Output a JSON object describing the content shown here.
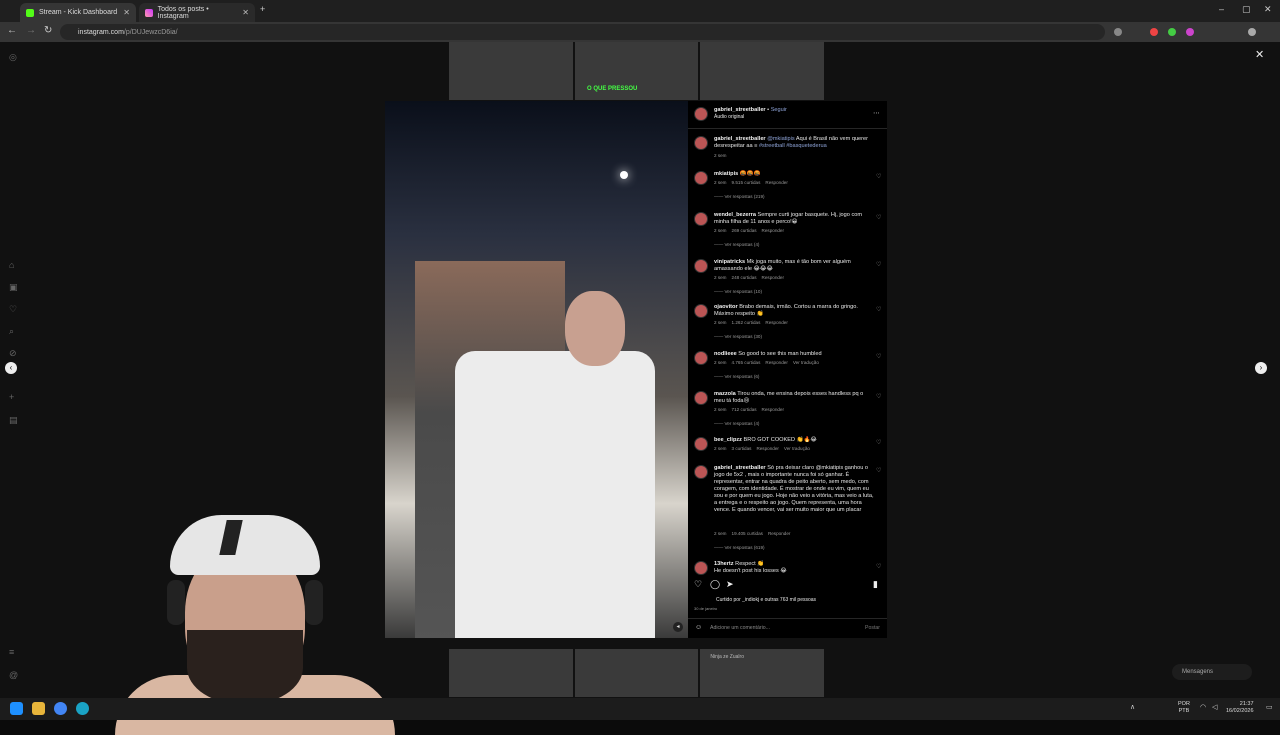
{
  "browser": {
    "tabs": [
      {
        "title": "Stream - Kick Dashboard"
      },
      {
        "title": "Todos os posts • Instagram"
      }
    ],
    "url_host": "instagram.com",
    "url_path": "/p/DUJewzcD6ia/"
  },
  "post": {
    "author": "gabriel_streetballer",
    "follow_label": "Seguir",
    "audio": "Áudio original",
    "caption_user": "gabriel_streetballer",
    "caption_mention": "@mkiatipis",
    "caption_text": "Aqui é Brasil não vem querer desrespeitar aa",
    "caption_tags": "#streetball #basquetederua",
    "caption_time": "2 sem",
    "comments": [
      {
        "user": "mkiatipis",
        "text": "🤬🤬🤬",
        "time": "2 sem",
        "likes": "9.515 curtidas",
        "reply": "Responder",
        "replies": "Ver respostas (219)"
      },
      {
        "user": "wendel_bezerra",
        "text": "Sempre curti jogar basquete. Hj, jogo com minha filha de 11 anos e perco!😁",
        "time": "2 sem",
        "likes": "269 curtidas",
        "reply": "Responder",
        "replies": "Ver respostas (4)"
      },
      {
        "user": "vinipatricks",
        "text": "Mk joga muito, mas é tão bom ver alguém amassando ele 😂😂😂",
        "time": "2 sem",
        "likes": "248 curtidas",
        "reply": "Responder",
        "replies": "Ver respostas (10)"
      },
      {
        "user": "ojaovitor",
        "text": "Brabo demais, irmão. Cortou a marra do gringo. Máximo respeito 👏",
        "time": "2 sem",
        "likes": "1.262 curtidas",
        "reply": "Responder",
        "replies": "Ver respostas (30)"
      },
      {
        "user": "nodlieee",
        "text": "So good to see this man humbled",
        "time": "2 sem",
        "likes": "4.765 curtidas",
        "reply": "Responder",
        "translate": "Ver tradução",
        "replies": "Ver respostas (6)"
      },
      {
        "user": "mazzola",
        "text": "Tirou onda, me ensina depois esses handless pq o meu tá foda😢",
        "time": "2 sem",
        "likes": "712 curtidas",
        "reply": "Responder",
        "replies": "Ver respostas (4)"
      },
      {
        "user": "bee_clipzz",
        "text": "BRO GOT COOKED 👏🔥😂",
        "time": "2 sem",
        "likes": "3 curtidas",
        "reply": "Responder",
        "translate": "Ver tradução"
      },
      {
        "user": "gabriel_streetballer",
        "mention": "@mkiatipis",
        "text": "Só pra deixar claro @mkiatipis ganhou o jogo de 5x2 , mais o importante nunca foi só ganhar. É representar, entrar na quadra de peito aberto, sem medo, com coragem, com identidade. É mostrar de onde eu vim, quem eu sou e por quem eu jogo. Hoje não veio a vitória, mas veio a luta, a entrega e o respeito ao jogo. Quem representa, uma hora vence. E quando vencer, vai ser muito maior que um placar",
        "time": "2 sem",
        "likes": "19.405 curtidas",
        "reply": "Responder",
        "replies": "Ver respostas (619)"
      },
      {
        "user": "13hertz",
        "text": "Respect 👏",
        "text2": "He doesn't post his losses 😂"
      }
    ],
    "liked_by": "Curtido por _indiokj e outras 763 mil pessoas",
    "date": "30 de janeiro",
    "comment_placeholder": "Adicione um comentário...",
    "post_button": "Postar"
  },
  "page": {
    "thumb_caption": "O QUE PRESSOU",
    "messages_label": "Mensagens",
    "bottom_user": "Ninja ze Zualro"
  },
  "taskbar": {
    "lang": "POR",
    "layout": "PTB",
    "time": "21:37",
    "date": "16/02/2026"
  },
  "colors": {
    "accent_link": "#8fa4d8",
    "kick_green": "#53fc18"
  }
}
